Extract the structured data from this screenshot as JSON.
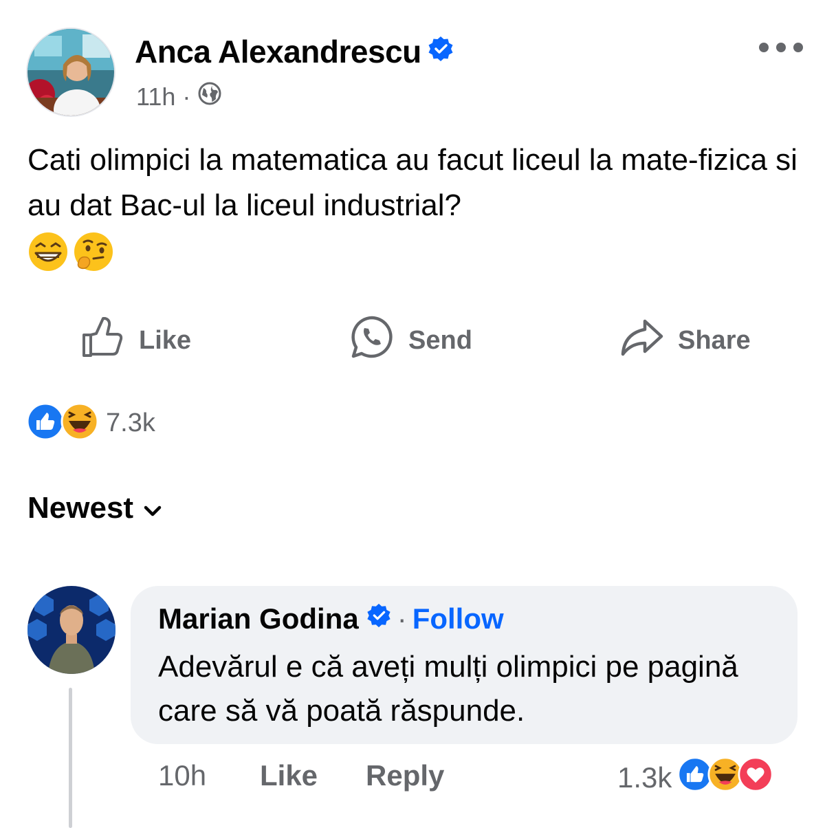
{
  "post": {
    "author": "Anca Alexandrescu",
    "time": "11h",
    "separator": "·",
    "text": "Cati olimpici la matematica au facut liceul la mate-fizica si au dat Bac-ul la liceul industrial?",
    "emojis": [
      "grinning-squinting-face",
      "thinking-face"
    ],
    "privacy_icon": "globe-icon",
    "more_icon": "more-options-icon"
  },
  "actions": {
    "like": "Like",
    "send": "Send",
    "share": "Share"
  },
  "reactions": {
    "types": [
      "like",
      "haha"
    ],
    "count": "7.3k"
  },
  "sort": {
    "label": "Newest"
  },
  "comment": {
    "author": "Marian Godina",
    "separator": "·",
    "follow": "Follow",
    "text": "Adevărul e că aveți mulți olimpici pe pagină care să vă poată răspunde.",
    "time": "10h",
    "like": "Like",
    "reply": "Reply",
    "reaction_count": "1.3k",
    "reaction_types": [
      "like",
      "haha",
      "love"
    ]
  },
  "colors": {
    "accent": "#0866ff",
    "secondary_text": "#65676b",
    "bubble": "#f0f2f5",
    "love": "#f33e58",
    "haha": "#f7b125"
  }
}
